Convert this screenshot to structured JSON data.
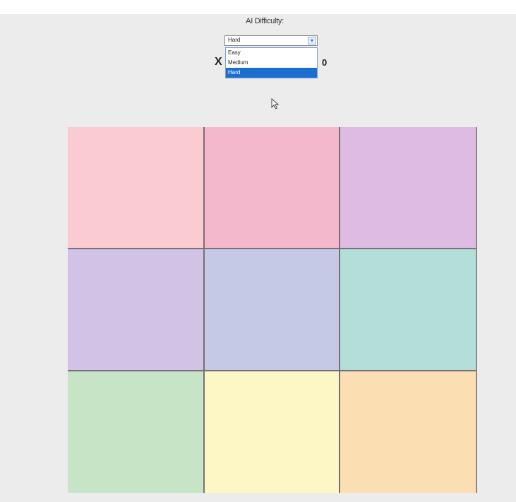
{
  "difficulty": {
    "label": "AI Difficulty:",
    "selected_value": "Hard",
    "options": [
      "Easy",
      "Medium",
      "Hard"
    ],
    "highlighted_option": "Hard"
  },
  "score": {
    "x_label": "X",
    "o_value": "0"
  },
  "board": {
    "cells": [
      {
        "color": "#fbcbd2"
      },
      {
        "color": "#f4b8cc"
      },
      {
        "color": "#debbe2"
      },
      {
        "color": "#d1c3e6"
      },
      {
        "color": "#c6c9e6"
      },
      {
        "color": "#b3dfd8"
      },
      {
        "color": "#c7e4c7"
      },
      {
        "color": "#fcf7c4"
      },
      {
        "color": "#fbdfb2"
      }
    ]
  },
  "colors": {
    "background": "#ececec",
    "grid_line": "#7a6e78",
    "selection": "#1c6fd0"
  }
}
